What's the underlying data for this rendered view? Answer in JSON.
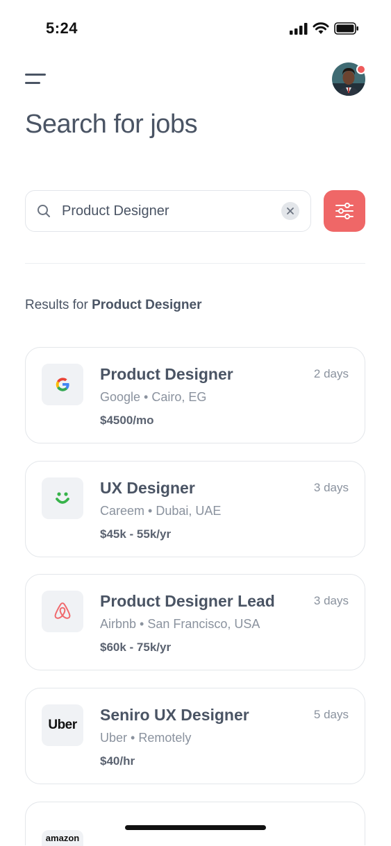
{
  "status": {
    "time": "5:24"
  },
  "header": {
    "menu_icon": "hamburger-menu-icon",
    "avatar_icon": "user-avatar",
    "notification_color": "#ef5b5b"
  },
  "title": "Search for jobs",
  "search": {
    "value": "Product Designer",
    "placeholder": "",
    "icon": "search-icon",
    "clear_icon": "close-icon",
    "filter_icon": "sliders-icon",
    "accent": "#ef6767"
  },
  "results": {
    "prefix": "Results for",
    "query": "Product Designer"
  },
  "jobs": [
    {
      "title": "Product Designer",
      "company": "Google",
      "location": "Cairo, EG",
      "meta": "Google • Cairo, EG",
      "salary": "$4500/mo",
      "age": "2 days",
      "logo": "google-logo"
    },
    {
      "title": "UX Designer",
      "company": "Careem",
      "location": "Dubai, UAE",
      "meta": "Careem • Dubai, UAE",
      "salary": "$45k - 55k/yr",
      "age": "3 days",
      "logo": "careem-logo"
    },
    {
      "title": "Product Designer Lead",
      "company": "Airbnb",
      "location": "San Francisco, USA",
      "meta": "Airbnb • San Francisco, USA",
      "salary": "$60k - 75k/yr",
      "age": "3 days",
      "logo": "airbnb-logo"
    },
    {
      "title": "Seniro UX Designer",
      "company": "Uber",
      "location": "Remotely",
      "meta": "Uber • Remotely",
      "salary": "$40/hr",
      "age": "5 days",
      "logo": "uber-logo",
      "logo_text": "Uber"
    },
    {
      "logo": "amazon-logo",
      "logo_text": "amazon"
    }
  ]
}
